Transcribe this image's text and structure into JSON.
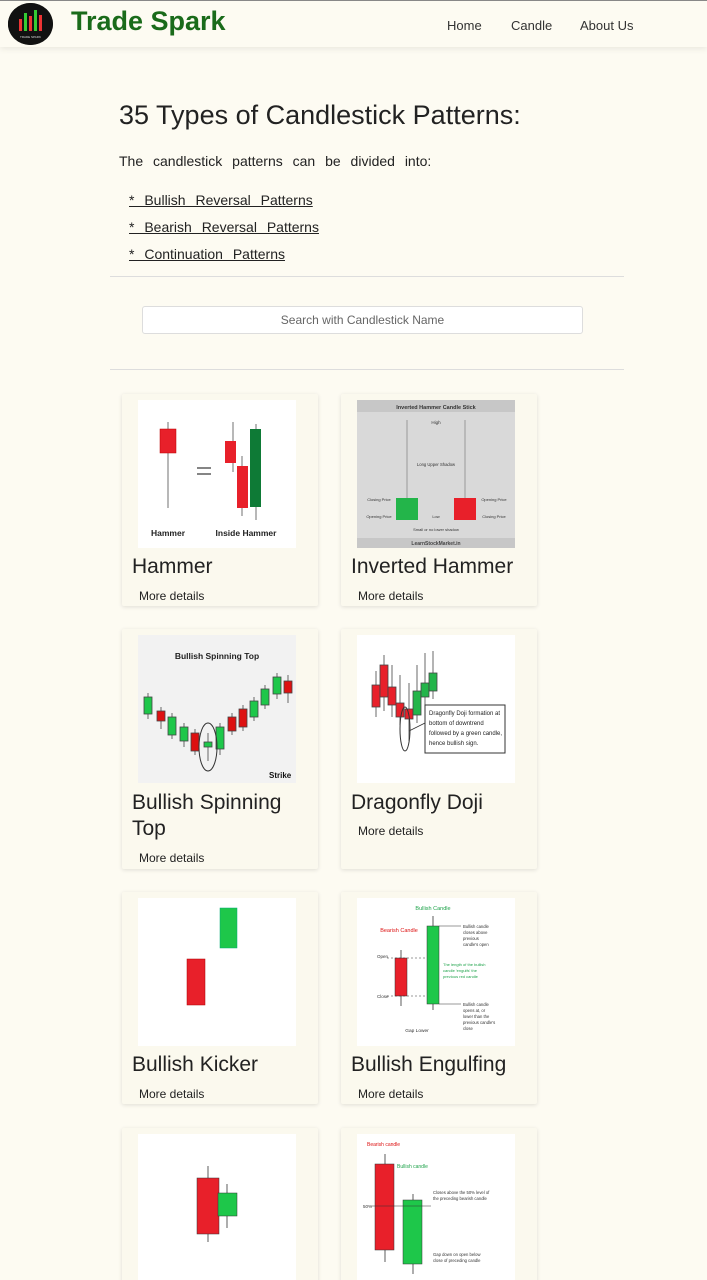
{
  "header": {
    "brand": "Trade Spark",
    "logo_caption": "TRADE SPARK",
    "nav": [
      "Home",
      "Candle",
      "About Us"
    ]
  },
  "main": {
    "heading": "35 Types of Candlestick Patterns:",
    "intro": "The candlestick patterns can be divided into:",
    "categories": [
      "* Bullish Reversal Patterns",
      "* Bearish Reversal Patterns",
      "* Continuation Patterns"
    ],
    "search_placeholder": "Search with Candlestick Name"
  },
  "cards": [
    {
      "title": "Hammer",
      "more": "More details",
      "image_labels": [
        "Hammer",
        "Inside Hammer"
      ]
    },
    {
      "title": "Inverted Hammer",
      "more": "More details",
      "image_labels": [
        "Inverted Hammer Candle Stick",
        "High",
        "Long Upper Shadow",
        "Closing Price",
        "Opening Price",
        "Low",
        "Opening Price",
        "Closing Price",
        "Small or no lower shadow",
        "LearnStockMarket.in"
      ]
    },
    {
      "title": "Bullish Spinning Top",
      "more": "More details",
      "image_labels": [
        "Bullish Spinning Top",
        "Strike"
      ]
    },
    {
      "title": "Dragonfly Doji",
      "more": "More details",
      "image_labels": [
        "Dragonfly Doji formation at",
        "bottom of downtrend",
        "followed by a green candle,",
        "hence bullish sign."
      ]
    },
    {
      "title": "Bullish Kicker",
      "more": "More details",
      "image_labels": []
    },
    {
      "title": "Bullish Engulfing",
      "more": "More details",
      "image_labels": [
        "Bullish Candle",
        "Bearish Candle",
        "Open",
        "Close",
        "Gap Lower",
        "Bullish candle",
        "closes above",
        "previous",
        "candle's open",
        "The length of the bullish",
        "candle 'engulfs' the",
        "previous red candle",
        "Bullish candle",
        "opens at, or",
        "lower than the",
        "previous candle's",
        "close"
      ]
    },
    {
      "title": "",
      "more": "",
      "image_labels": []
    },
    {
      "title": "",
      "more": "",
      "image_labels": [
        "Bearish candle",
        "Bullish candle",
        "50%",
        "Closes above the 50% level of",
        "the preceding bearish candle",
        "Gap down on open below",
        "close of preceding candle"
      ]
    }
  ],
  "colors": {
    "background": "#fdfbf2",
    "brand_green": "#1a6b1a",
    "candle_red": "#e8202a",
    "candle_green": "#1ec74a",
    "dark_green": "#0e7a36"
  }
}
